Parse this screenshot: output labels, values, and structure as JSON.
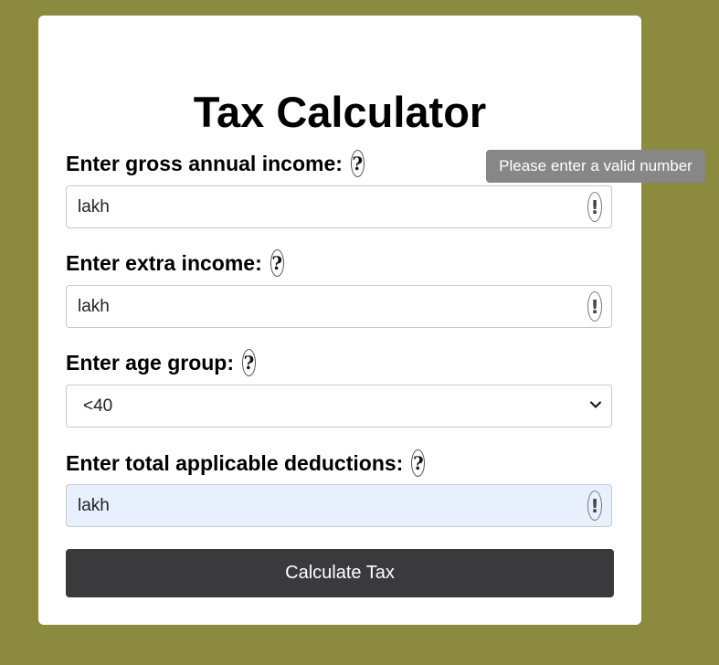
{
  "title": "Tax Calculator",
  "fields": [
    {
      "label": "Enter gross annual income:",
      "value": "lakh"
    },
    {
      "label": "Enter extra income:",
      "value": "lakh"
    },
    {
      "label": "Enter age group:",
      "value": "<40"
    },
    {
      "label": "Enter total applicable deductions:",
      "value": "lakh"
    }
  ],
  "help_glyph": "?",
  "warn_glyph": "!",
  "button": {
    "label": "Calculate Tax"
  },
  "tooltip": "Please enter a valid number",
  "colors": {
    "background": "#8b8a3f",
    "card": "#ffffff",
    "button": "#3a393b",
    "tooltip": "#878787",
    "autofill": "#e8f0fe"
  }
}
